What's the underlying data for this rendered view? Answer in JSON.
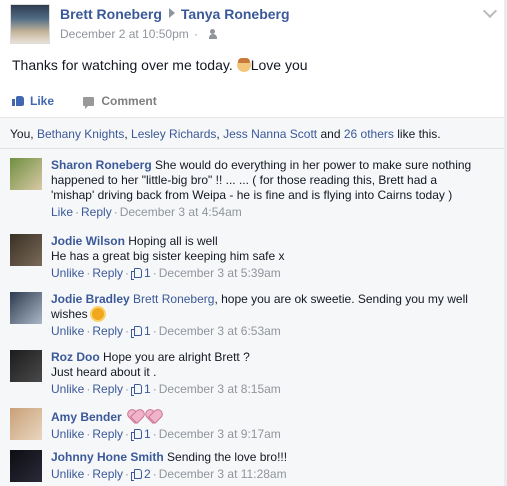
{
  "post": {
    "author": "Brett Roneberg",
    "target": "Tanya Roneberg",
    "timestamp": "December 2 at 10:50pm",
    "audience_icon": "friends-icon",
    "text": "Thanks for watching over me today.",
    "text_suffix": "Love you",
    "emoji_icon": "angel-emoji-icon"
  },
  "actions": {
    "like_label": "Like",
    "comment_label": "Comment"
  },
  "likes": {
    "you": "You,",
    "names": [
      "Bethany Knights",
      "Lesley Richards",
      "Jess Nanna Scott"
    ],
    "and": "and",
    "others": "26 others",
    "suffix": "like this."
  },
  "comments": [
    {
      "author": "Sharon Roneberg",
      "lines": [
        "She would do everything in her power to make sure nothing",
        "happened to her \"little-big bro\" !! ... ... ( for those reading this, Brett had a",
        "'mishap' driving back from Weipa - he is fine and is flying into Cairns today )"
      ],
      "like_label": "Like",
      "reply_label": "Reply",
      "like_count": "",
      "time": "December 3 at 4:54am",
      "avatar_colors": [
        "#6f8f3f",
        "#d9c9a6"
      ]
    },
    {
      "author": "Jodie Wilson",
      "lines": [
        "Hoping all is well",
        "He has a great big sister keeping him safe x"
      ],
      "like_label": "Unlike",
      "reply_label": "Reply",
      "like_count": "1",
      "time": "December 3 at 5:39am",
      "avatar_colors": [
        "#3a3026",
        "#7a6a58"
      ]
    },
    {
      "author": "Jodie Bradley",
      "mention": "Brett Roneberg",
      "lines": [
        ", hope you are ok sweetie. Sending you my well",
        "wishes"
      ],
      "emoji_icon": "sun-emoji-icon",
      "like_label": "Unlike",
      "reply_label": "Reply",
      "like_count": "1",
      "time": "December 3 at 6:53am",
      "avatar_colors": [
        "#2d3b4f",
        "#aab7c6"
      ]
    },
    {
      "author": "Roz Doo",
      "lines": [
        "Hope you are alright Brett ?",
        "Just heard about it ."
      ],
      "like_label": "Unlike",
      "reply_label": "Reply",
      "like_count": "1",
      "time": "December 3 at 8:15am",
      "avatar_colors": [
        "#1c1c1c",
        "#4a4a4a"
      ]
    },
    {
      "author": "Amy Bender",
      "lines": [
        ""
      ],
      "heart_icons": 2,
      "like_label": "Unlike",
      "reply_label": "Reply",
      "like_count": "1",
      "time": "December 3 at 9:17am",
      "avatar_colors": [
        "#c8a078",
        "#e9d6bf"
      ]
    },
    {
      "author": "Johnny Hone Smith",
      "lines": [
        "Sending the love bro!!!"
      ],
      "like_label": "Unlike",
      "reply_label": "Reply",
      "like_count": "2",
      "time": "December 3 at 11:28am",
      "avatar_colors": [
        "#0d0d14",
        "#2a2a38"
      ]
    }
  ],
  "colors": {
    "link": "#3b5998",
    "meta": "#90949c",
    "panel_bg": "#f6f7f9",
    "like_active": "#4267b2"
  }
}
